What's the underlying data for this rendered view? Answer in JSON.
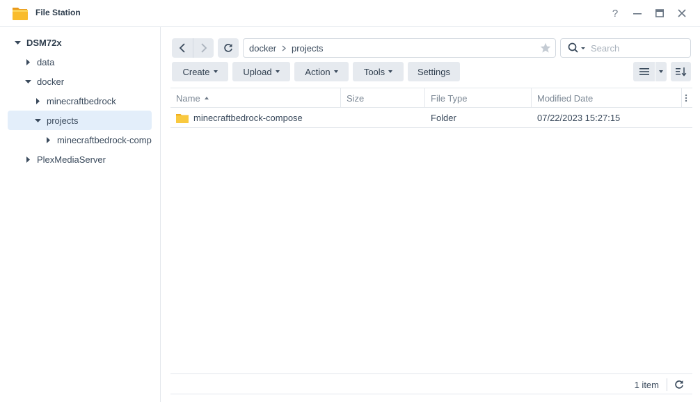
{
  "window": {
    "title": "File Station",
    "help_glyph": "?"
  },
  "tree": {
    "root": "DSM72x",
    "items": [
      {
        "label": "data",
        "level": 1,
        "expanded": false
      },
      {
        "label": "docker",
        "level": 1,
        "expanded": true
      },
      {
        "label": "minecraftbedrock",
        "level": 2,
        "expanded": false
      },
      {
        "label": "projects",
        "level": 2,
        "expanded": true,
        "selected": true
      },
      {
        "label": "minecraftbedrock-compose",
        "level": 3,
        "expanded": false
      },
      {
        "label": "PlexMediaServer",
        "level": 1,
        "expanded": false
      }
    ]
  },
  "path": {
    "segments": [
      "docker",
      "projects"
    ]
  },
  "search": {
    "placeholder": "Search"
  },
  "toolbar": {
    "create": "Create",
    "upload": "Upload",
    "action": "Action",
    "tools": "Tools",
    "settings": "Settings"
  },
  "grid": {
    "columns": [
      "Name",
      "Size",
      "File Type",
      "Modified Date"
    ],
    "rows": [
      {
        "name": "minecraftbedrock-compose",
        "size": "",
        "type": "Folder",
        "modified": "07/22/2023 15:27:15"
      }
    ]
  },
  "status": {
    "count": "1 item"
  },
  "colors": {
    "accent": "#0086e5",
    "selected_bg": "#e3eefa",
    "button_bg": "#e6eaef",
    "folder": "#f9c93f"
  }
}
